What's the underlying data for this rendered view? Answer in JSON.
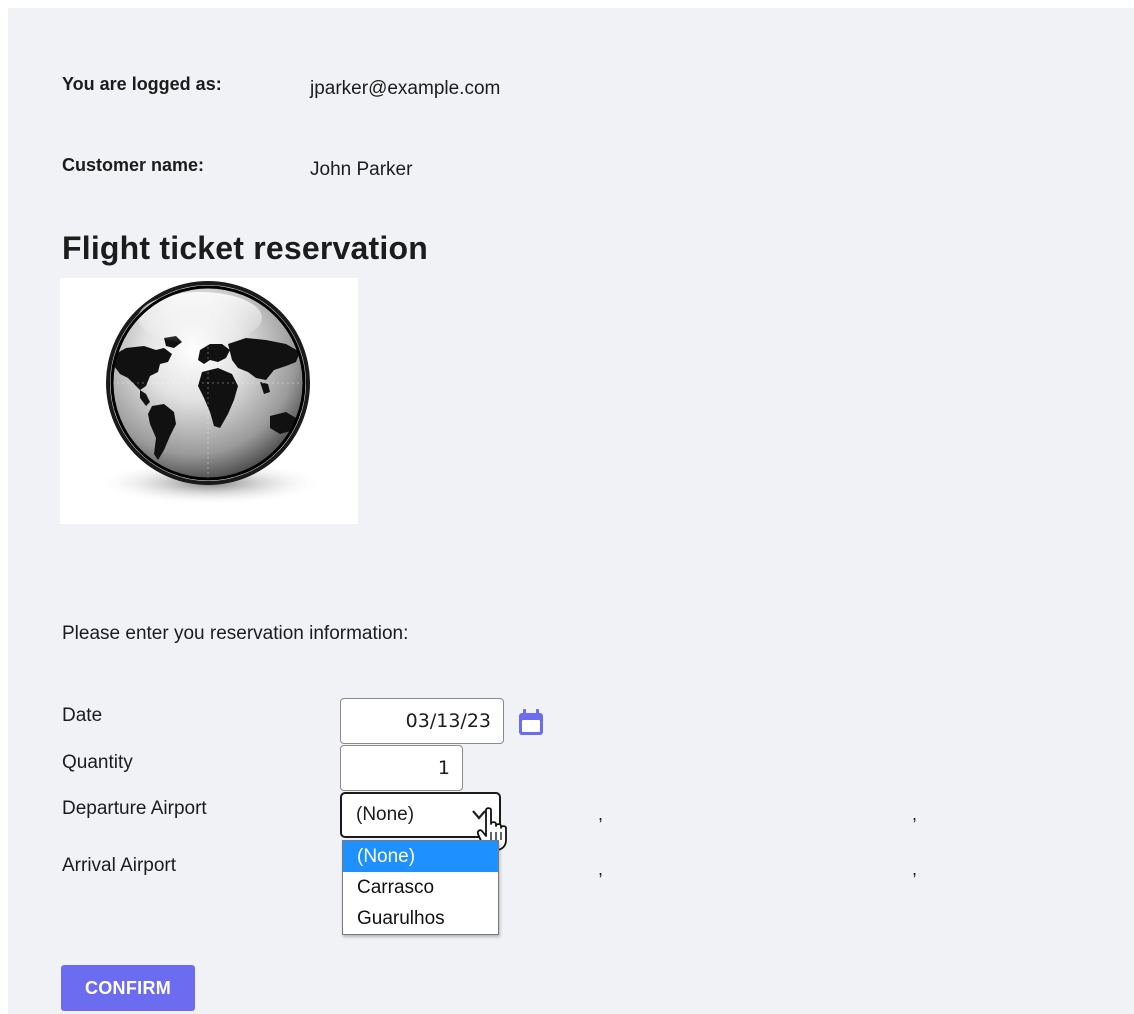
{
  "user": {
    "logged_label": "You are logged as:",
    "logged_value": "jparker@example.com",
    "customer_label": "Customer name:",
    "customer_value": "John Parker"
  },
  "page_title": "Flight ticket reservation",
  "image_icon": "globe-world-map-icon",
  "form": {
    "intro": "Please enter you reservation information:",
    "date_label": "Date",
    "date_value": "03/13/23",
    "calendar_icon": "calendar-icon",
    "quantity_label": "Quantity",
    "quantity_value": "1",
    "departure_label": "Departure Airport",
    "departure_selected": "(None)",
    "departure_options": [
      "(None)",
      "Carrasco",
      "Guarulhos"
    ],
    "arrival_label": "Arrival Airport",
    "separator": ",",
    "confirm_label": "CONFIRM"
  },
  "colors": {
    "page_bg": "#f0f2f5",
    "accent": "#6c6cf0",
    "selected_option": "#1e90ff"
  }
}
